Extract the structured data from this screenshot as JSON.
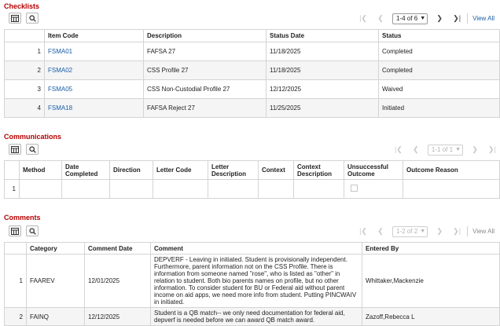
{
  "checklists": {
    "title": "Checklists",
    "pagination": {
      "range": "1-4 of 6",
      "view_all": "View All"
    },
    "columns": [
      "",
      "Item Code",
      "Description",
      "Status Date",
      "Status"
    ],
    "rows": [
      {
        "num": "1",
        "item_code": "FSMA01",
        "description": "FAFSA 27",
        "status_date": "11/18/2025",
        "status": "Completed"
      },
      {
        "num": "2",
        "item_code": "FSMA02",
        "description": "CSS Profile 27",
        "status_date": "11/18/2025",
        "status": "Completed"
      },
      {
        "num": "3",
        "item_code": "FSMA05",
        "description": "CSS Non-Custodial Profile 27",
        "status_date": "12/12/2025",
        "status": "Waived"
      },
      {
        "num": "4",
        "item_code": "FSMA18",
        "description": "FAFSA Reject 27",
        "status_date": "11/25/2025",
        "status": "Initiated"
      }
    ]
  },
  "communications": {
    "title": "Communications",
    "pagination": {
      "range": "1-1 of 1"
    },
    "columns": [
      "",
      "Method",
      "Date Completed",
      "Direction",
      "Letter Code",
      "Letter Description",
      "Context",
      "Context Description",
      "Unsuccessful Outcome",
      "Outcome Reason"
    ],
    "rows": [
      {
        "num": "1"
      }
    ]
  },
  "comments": {
    "title": "Comments",
    "pagination": {
      "range": "1-2 of 2",
      "view_all": "View All"
    },
    "columns": [
      "",
      "Category",
      "Comment Date",
      "Comment",
      "Entered By"
    ],
    "rows": [
      {
        "num": "1",
        "category": "FAAREV",
        "comment_date": "12/01/2025",
        "comment": "DEPVERF - Leaving in initiated. Student is provisionally independent. Furthermore, parent information not on the CSS Profile. There is information from someone named \"rose\", who is listed as \"other\" in relation to student. Both bio parents names on profile, but no other information. To consider student for BU or Federal aid without parent income on aid apps, we need more info from student. Putting PINCWAIV in initiated.",
        "entered_by": "Whittaker,Mackenzie"
      },
      {
        "num": "2",
        "category": "FAINQ",
        "comment_date": "12/12/2025",
        "comment": "Student is a QB match-- we only need documentation for federal aid, depverf is needed before we can award QB match award.",
        "entered_by": "Zazoff,Rebecca L"
      }
    ]
  },
  "icons": {
    "grid": "grid-settings-icon",
    "search": "search-icon",
    "first": "first-page-icon",
    "prev": "previous-page-icon",
    "next": "next-page-icon",
    "last": "last-page-icon"
  },
  "colors": {
    "section_title": "#b50000",
    "link": "#1a5ea8"
  }
}
